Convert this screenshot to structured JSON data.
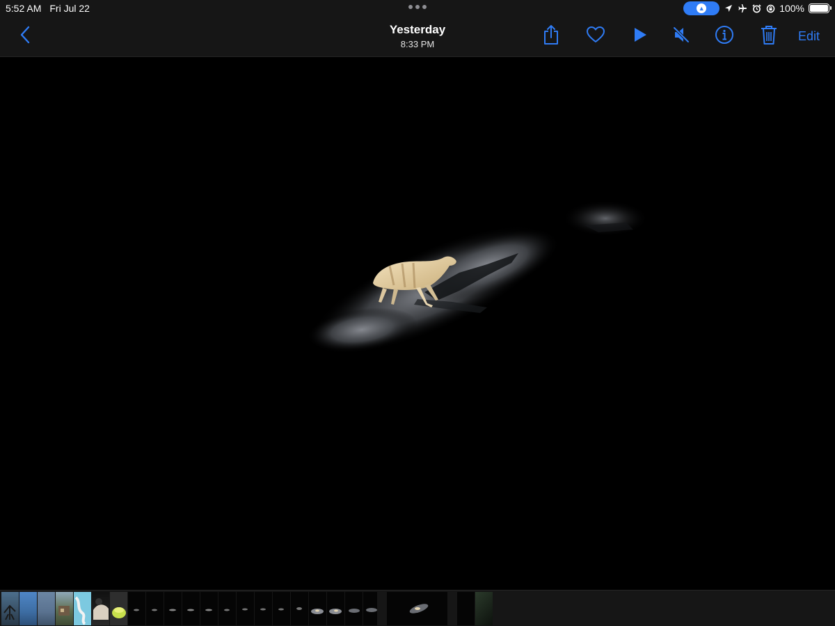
{
  "status_bar": {
    "time": "5:52 AM",
    "date": "Fri Jul 22",
    "battery": "100%",
    "icons": [
      "location-icon",
      "airplane-mode-icon",
      "alarm-icon",
      "orientation-lock-icon",
      "battery-icon"
    ]
  },
  "nav": {
    "title": "Yesterday",
    "subtitle": "8:33 PM",
    "edit_label": "Edit",
    "buttons": [
      "back-icon",
      "share-icon",
      "heart-icon",
      "play-icon",
      "mute-icon",
      "info-icon",
      "trash-icon"
    ]
  },
  "colors": {
    "accent": "#2f7cf6",
    "bar_bg": "#161616",
    "photo_bg": "#000000"
  }
}
